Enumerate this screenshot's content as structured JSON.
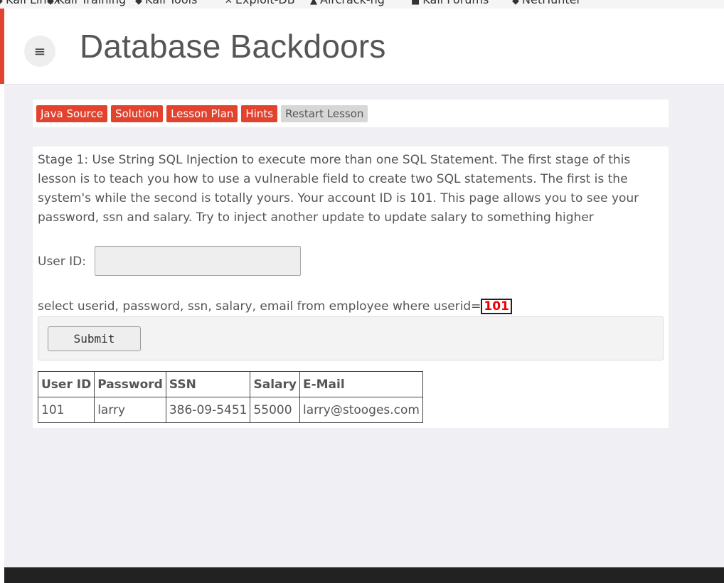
{
  "bookmarks": [
    {
      "label": "Kali Linux",
      "icon": "◆"
    },
    {
      "label": "Kali Training",
      "icon": "◆"
    },
    {
      "label": "Kali Tools",
      "icon": "◆"
    },
    {
      "label": "Exploit-DB",
      "icon": "✕"
    },
    {
      "label": "Aircrack-ng",
      "icon": "▲"
    },
    {
      "label": "Kali Forums",
      "icon": "■"
    },
    {
      "label": "NetHunter",
      "icon": "◆"
    }
  ],
  "header": {
    "title": "Database Backdoors",
    "menu_icon": "≡"
  },
  "toolbar": {
    "buttons": [
      "Java Source",
      "Solution",
      "Lesson Plan",
      "Hints",
      "Restart Lesson"
    ]
  },
  "lesson": {
    "description": "Stage 1: Use String SQL Injection to execute more than one SQL Statement. The first stage of this lesson is to teach you how to use a vulnerable field to create two SQL statements. The first is the system's while the second is totally yours. Your account ID is 101. This page allows you to see your password, ssn and salary. Try to inject another update to update salary to something higher",
    "userid_label": "User ID:",
    "userid_value": "",
    "query_text": "select userid, password, ssn, salary, email from employee where userid=",
    "query_value": "101",
    "submit_label": "Submit"
  },
  "results": {
    "headers": [
      "User ID",
      "Password",
      "SSN",
      "Salary",
      "E-Mail"
    ],
    "rows": [
      [
        "101",
        "larry",
        "386-09-5451",
        "55000",
        "larry@stooges.com"
      ]
    ]
  },
  "colors": {
    "accent": "#e2432f",
    "footer": "#222222",
    "query_highlight": "#ee0000"
  }
}
